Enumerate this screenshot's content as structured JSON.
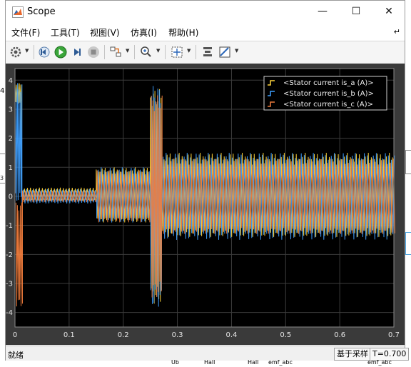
{
  "window": {
    "title": "Scope"
  },
  "menu": [
    {
      "label": "文件(F)"
    },
    {
      "label": "工具(T)"
    },
    {
      "label": "视图(V)"
    },
    {
      "label": "仿真(I)"
    },
    {
      "label": "帮助(H)"
    }
  ],
  "legend": [
    {
      "label": "<Stator current is_a (A)>",
      "color": "#ffd43b"
    },
    {
      "label": "<Stator current is_b (A)>",
      "color": "#3e9fff"
    },
    {
      "label": "<Stator current is_c (A)>",
      "color": "#f07c3c"
    }
  ],
  "chart_data": {
    "type": "line",
    "x_range": [
      0,
      0.7
    ],
    "y_range": [
      -4.5,
      4.4
    ],
    "xticks": [
      "0",
      "0.1",
      "0.2",
      "0.3",
      "0.4",
      "0.5",
      "0.6",
      "0.7"
    ],
    "yticks": [
      "4",
      "3",
      "2",
      "1",
      "0",
      "-1",
      "-2",
      "-3",
      "-4"
    ],
    "grid": true,
    "legend_position": "top-right",
    "series": [
      {
        "name": "<Stator current is_a (A)>",
        "segments": [
          {
            "t": [
              0,
              0.012
            ],
            "lo": 3.2,
            "hi": 3.9
          },
          {
            "t": [
              0.012,
              0.15
            ],
            "lo": -0.15,
            "hi": 0.3
          },
          {
            "t": [
              0.15,
              0.25
            ],
            "lo": -0.9,
            "hi": 1.0
          },
          {
            "t": [
              0.25,
              0.27
            ],
            "lo": -3.7,
            "hi": 3.7
          },
          {
            "t": [
              0.27,
              0.7
            ],
            "lo": -1.4,
            "hi": 1.5
          }
        ]
      },
      {
        "name": "<Stator current is_b (A)>",
        "segments": [
          {
            "t": [
              0,
              0.012
            ],
            "lo": -0.2,
            "hi": 3.9
          },
          {
            "t": [
              0.012,
              0.15
            ],
            "lo": -0.25,
            "hi": 0.25
          },
          {
            "t": [
              0.15,
              0.25
            ],
            "lo": -0.9,
            "hi": 1.0
          },
          {
            "t": [
              0.25,
              0.27
            ],
            "lo": -3.8,
            "hi": 3.8
          },
          {
            "t": [
              0.27,
              0.7
            ],
            "lo": -1.5,
            "hi": 1.5
          }
        ]
      },
      {
        "name": "<Stator current is_c (A)>",
        "segments": [
          {
            "t": [
              0,
              0.012
            ],
            "lo": -3.8,
            "hi": -0.2
          },
          {
            "t": [
              0.012,
              0.15
            ],
            "lo": -0.2,
            "hi": 0.2
          },
          {
            "t": [
              0.15,
              0.25
            ],
            "lo": -0.9,
            "hi": 0.9
          },
          {
            "t": [
              0.25,
              0.27
            ],
            "lo": -3.5,
            "hi": 3.5
          },
          {
            "t": [
              0.27,
              0.7
            ],
            "lo": -1.3,
            "hi": 1.3
          }
        ]
      }
    ]
  },
  "status": {
    "ready": "就绪",
    "mode": "基于采样",
    "time": "T=0.700"
  },
  "below": {
    "labels": [
      "Ub",
      "Hall",
      "Hall",
      "emf_abc",
      "emf_abc"
    ]
  },
  "edge_left": {
    "tick": "4",
    "label": "3"
  }
}
